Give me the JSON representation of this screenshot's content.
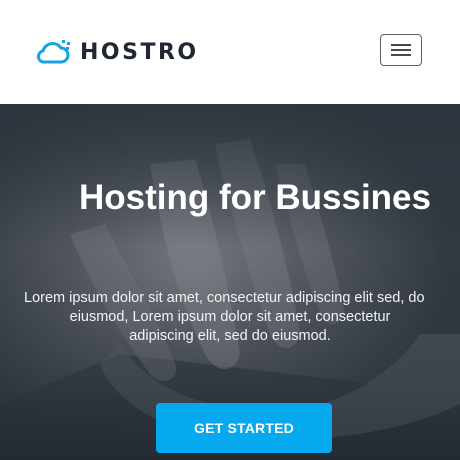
{
  "navbar": {
    "brand_text": "HOSTRO",
    "brand_icon": "cloud-icon",
    "menu_icon": "hamburger-menu-icon"
  },
  "hero": {
    "title": "Hosting for Bussines",
    "description_lines": [
      "Lorem ipsum dolor sit amet, consectetur adipiscing elit sed, do",
      "eiusmod, Lorem ipsum dolor sit amet, consectetur",
      "adipiscing elit, sed do eiusmod."
    ],
    "cta_label": "GET STARTED"
  },
  "colors": {
    "accent": "#06a9ed",
    "brand_text": "#1f2733",
    "hero_overlay": "#3c434b",
    "white": "#ffffff"
  }
}
